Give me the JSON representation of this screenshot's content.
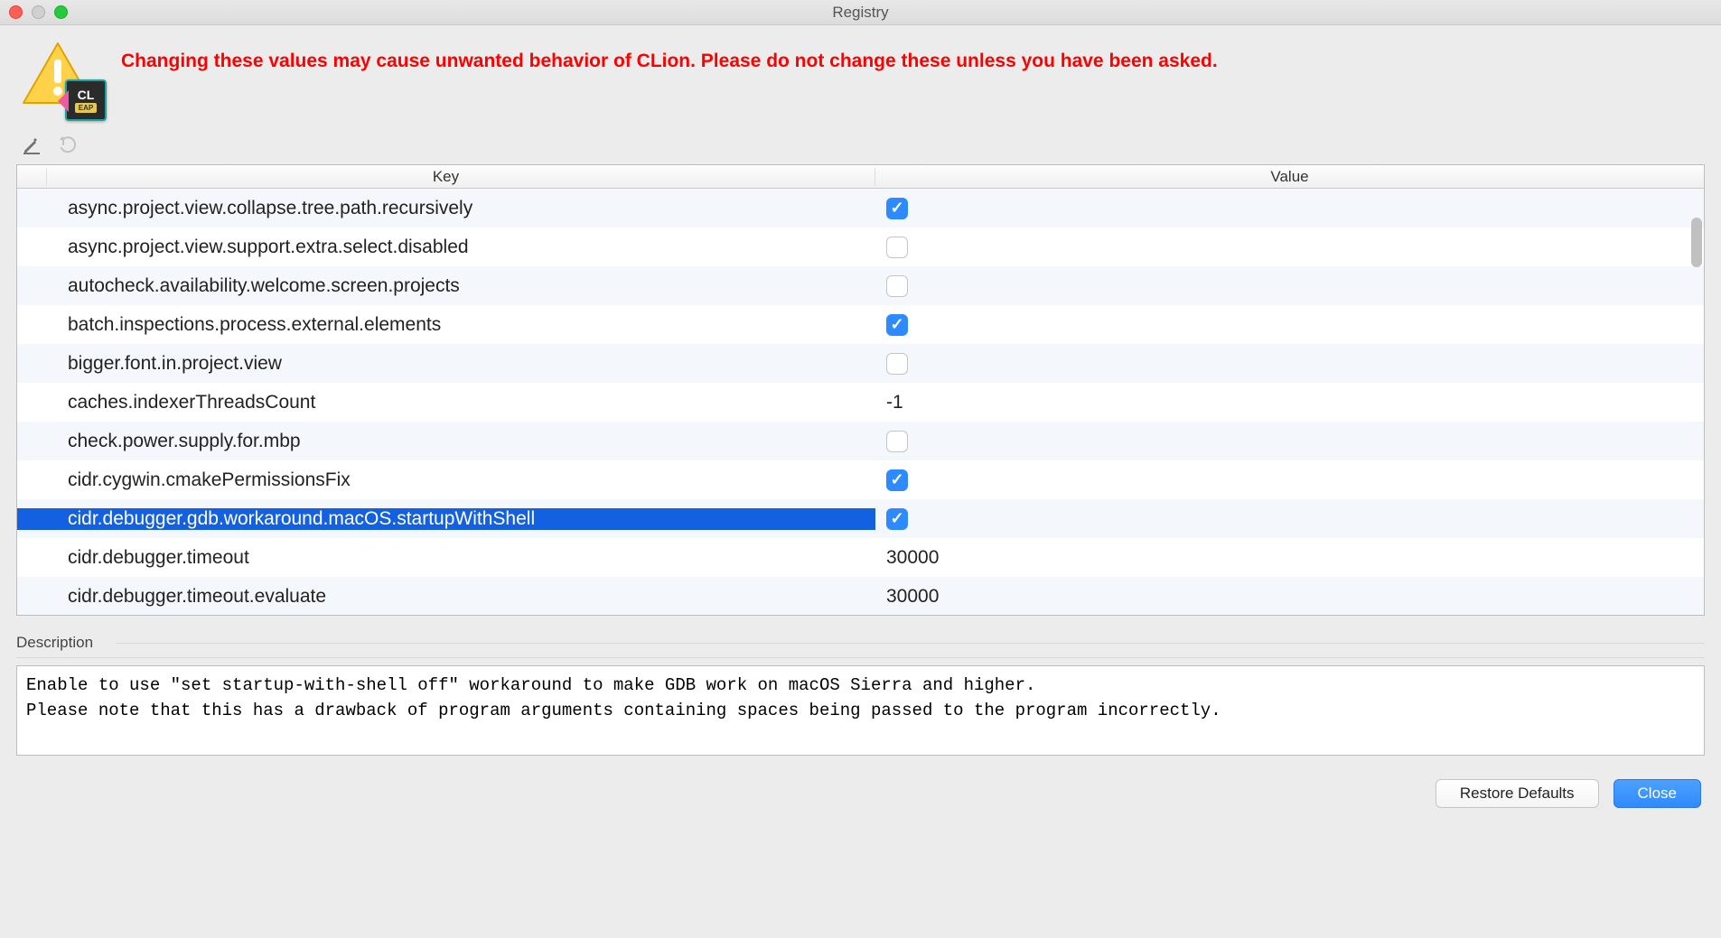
{
  "window": {
    "title": "Registry"
  },
  "warning": "Changing these values may cause unwanted behavior of CLion. Please do not change these unless you have been asked.",
  "app_badge": {
    "name": "CL",
    "tag": "EAP"
  },
  "table": {
    "headers": {
      "key": "Key",
      "value": "Value"
    },
    "rows": [
      {
        "key": "async.project.view.collapse.tree.path.recursively",
        "type": "bool",
        "value": true,
        "selected": false
      },
      {
        "key": "async.project.view.support.extra.select.disabled",
        "type": "bool",
        "value": false,
        "selected": false
      },
      {
        "key": "autocheck.availability.welcome.screen.projects",
        "type": "bool",
        "value": false,
        "selected": false
      },
      {
        "key": "batch.inspections.process.external.elements",
        "type": "bool",
        "value": true,
        "selected": false
      },
      {
        "key": "bigger.font.in.project.view",
        "type": "bool",
        "value": false,
        "selected": false
      },
      {
        "key": "caches.indexerThreadsCount",
        "type": "text",
        "value": "-1",
        "selected": false
      },
      {
        "key": "check.power.supply.for.mbp",
        "type": "bool",
        "value": false,
        "selected": false
      },
      {
        "key": "cidr.cygwin.cmakePermissionsFix",
        "type": "bool",
        "value": true,
        "selected": false
      },
      {
        "key": "cidr.debugger.gdb.workaround.macOS.startupWithShell",
        "type": "bool",
        "value": true,
        "selected": true
      },
      {
        "key": "cidr.debugger.timeout",
        "type": "text",
        "value": "30000",
        "selected": false
      },
      {
        "key": "cidr.debugger.timeout.evaluate",
        "type": "text",
        "value": "30000",
        "selected": false
      }
    ]
  },
  "description": {
    "label": "Description",
    "text": "Enable to use \"set startup-with-shell off\" workaround to make GDB work on macOS Sierra and higher.\nPlease note that this has a drawback of program arguments containing spaces being passed to the program incorrectly."
  },
  "buttons": {
    "restore": "Restore Defaults",
    "close": "Close"
  }
}
